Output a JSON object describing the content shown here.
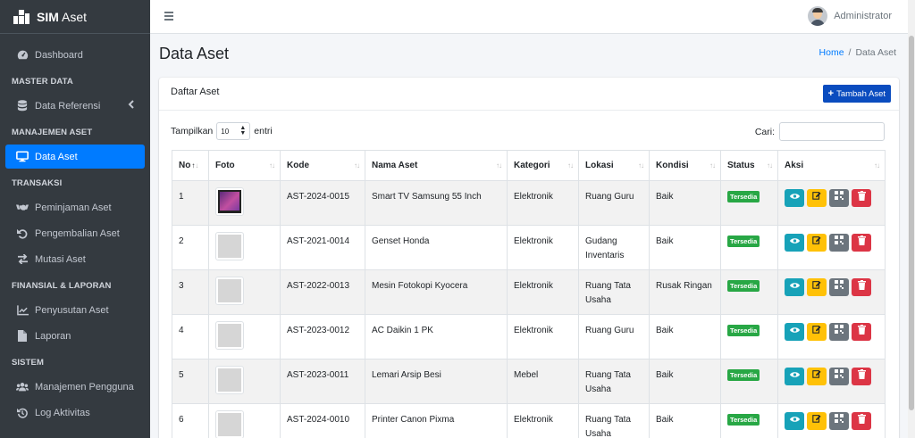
{
  "app": {
    "brand_bold": "SIM",
    "brand_rest": " Aset"
  },
  "sidebar": {
    "dashboard": "Dashboard",
    "header_master": "MASTER DATA",
    "data_referensi": "Data Referensi",
    "header_manajemen": "MANAJEMEN ASET",
    "data_aset": "Data Aset",
    "header_transaksi": "TRANSAKSI",
    "peminjaman": "Peminjaman Aset",
    "pengembalian": "Pengembalian Aset",
    "mutasi": "Mutasi Aset",
    "header_finansial": "FINANSIAL & LAPORAN",
    "penyusutan": "Penyusutan Aset",
    "laporan": "Laporan",
    "header_sistem": "SISTEM",
    "manajemen_pengguna": "Manajemen Pengguna",
    "log_aktivitas": "Log Aktivitas"
  },
  "topbar": {
    "user_name": "Administrator"
  },
  "page": {
    "title": "Data Aset"
  },
  "breadcrumb": {
    "home": "Home",
    "sep": "/",
    "current": "Data Aset"
  },
  "card": {
    "title": "Daftar Aset",
    "add_button": "Tambah Aset",
    "show_label": "Tampilkan",
    "show_value": "10",
    "entries_label": "entri",
    "search_label": "Cari:"
  },
  "table": {
    "headers": [
      "No",
      "Foto",
      "Kode",
      "Nama Aset",
      "Kategori",
      "Lokasi",
      "Kondisi",
      "Status",
      "Aksi"
    ],
    "rows": [
      {
        "no": "1",
        "kode": "AST-2024-0015",
        "nama": "Smart TV Samsung 55 Inch",
        "kategori": "Elektronik",
        "lokasi": "Ruang Guru",
        "kondisi": "Baik",
        "status": "Tersedia"
      },
      {
        "no": "2",
        "kode": "AST-2021-0014",
        "nama": "Genset Honda",
        "kategori": "Elektronik",
        "lokasi": "Gudang Inventaris",
        "kondisi": "Baik",
        "status": "Tersedia"
      },
      {
        "no": "3",
        "kode": "AST-2022-0013",
        "nama": "Mesin Fotokopi Kyocera",
        "kategori": "Elektronik",
        "lokasi": "Ruang Tata Usaha",
        "kondisi": "Rusak Ringan",
        "status": "Tersedia"
      },
      {
        "no": "4",
        "kode": "AST-2023-0012",
        "nama": "AC Daikin 1 PK",
        "kategori": "Elektronik",
        "lokasi": "Ruang Guru",
        "kondisi": "Baik",
        "status": "Tersedia"
      },
      {
        "no": "5",
        "kode": "AST-2023-0011",
        "nama": "Lemari Arsip Besi",
        "kategori": "Mebel",
        "lokasi": "Ruang Tata Usaha",
        "kondisi": "Baik",
        "status": "Tersedia"
      },
      {
        "no": "6",
        "kode": "AST-2024-0010",
        "nama": "Printer Canon Pixma",
        "kategori": "Elektronik",
        "lokasi": "Ruang Tata Usaha",
        "kondisi": "Baik",
        "status": "Tersedia"
      }
    ]
  },
  "colors": {
    "sidebar": "#343a40",
    "active": "#007bff",
    "success": "#28a745",
    "info": "#17a2b8",
    "warning": "#ffc107",
    "secondary": "#6c757d",
    "danger": "#dc3545"
  }
}
